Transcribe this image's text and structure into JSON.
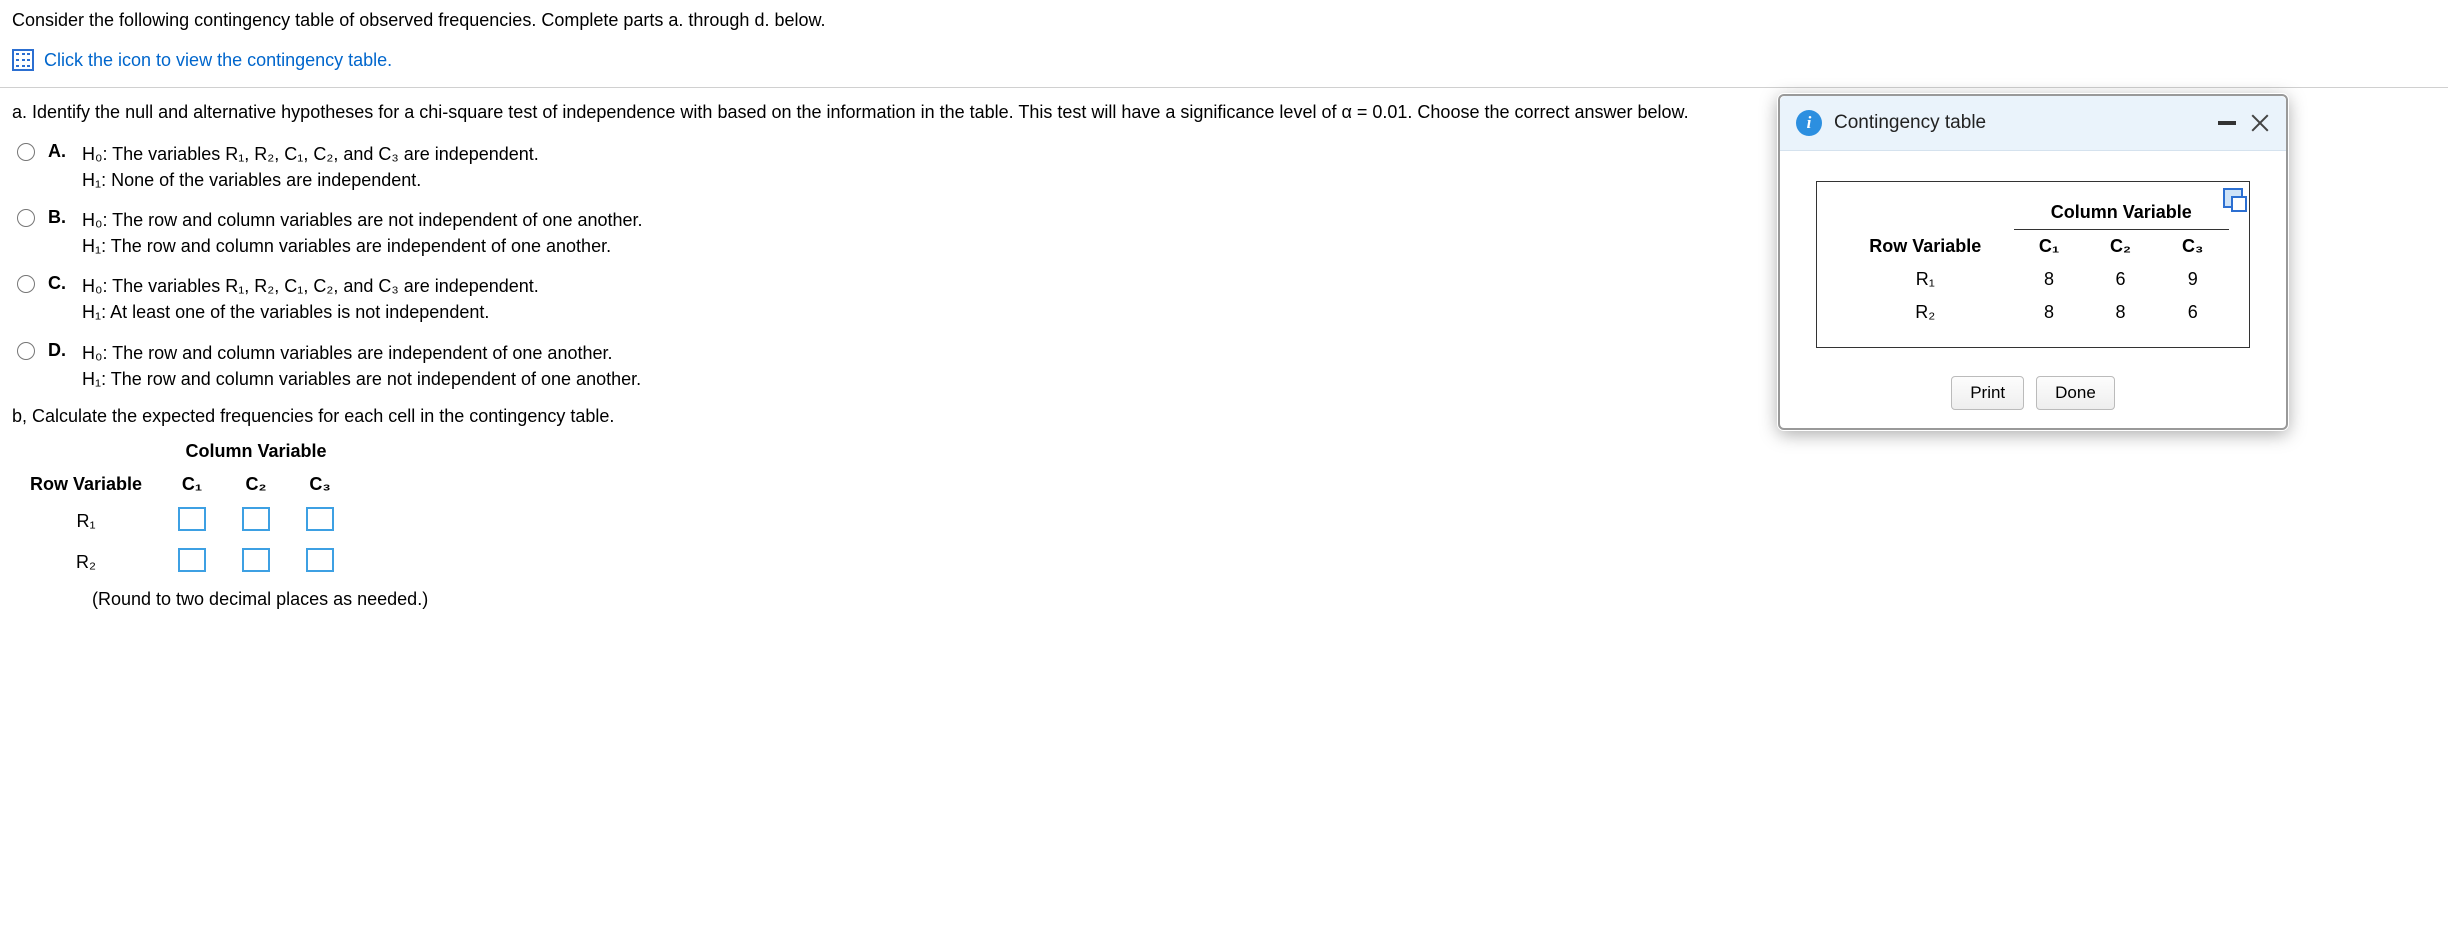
{
  "intro": "Consider the following contingency table of observed frequencies. Complete parts a. through d. below.",
  "iconLink": "Click the icon to view the contingency table.",
  "partA": {
    "prompt": "a. Identify the null and alternative hypotheses for a chi-square test of independence with  based on the information in the table. This test will have a significance level of α = 0.01. Choose the correct answer below.",
    "choices": {
      "A": {
        "h0": "The variables R₁, R₂, C₁, C₂, and C₃ are independent.",
        "h1": "None of the variables are independent."
      },
      "B": {
        "h0": "The row and column variables are not independent of one another.",
        "h1": "The row and column variables are independent of one another."
      },
      "C": {
        "h0": "The variables R₁, R₂, C₁, C₂, and C₃ are independent.",
        "h1": "At least one of the variables is not independent."
      },
      "D": {
        "h0": "The row and column variables are independent of one another.",
        "h1": "The row and column variables are not independent of one another."
      }
    }
  },
  "partB": {
    "prompt": "b, Calculate the expected frequencies for each cell in the contingency table.",
    "colHeader": "Column Variable",
    "rowHeader": "Row Variable",
    "cols": [
      "C₁",
      "C₂",
      "C₃"
    ],
    "rows": [
      "R₁",
      "R₂"
    ],
    "note": "(Round to two decimal places as needed.)"
  },
  "popup": {
    "title": "Contingency table",
    "colHeader": "Column Variable",
    "rowHeader": "Row Variable",
    "cols": [
      "C₁",
      "C₂",
      "C₃"
    ],
    "rows": [
      {
        "label": "R₁",
        "vals": [
          8,
          6,
          9
        ]
      },
      {
        "label": "R₂",
        "vals": [
          8,
          8,
          6
        ]
      }
    ],
    "printLabel": "Print",
    "doneLabel": "Done"
  },
  "labels": {
    "A": "A.",
    "B": "B.",
    "C": "C.",
    "D": "D.",
    "H0": "H₀: ",
    "H1": "H₁: "
  }
}
